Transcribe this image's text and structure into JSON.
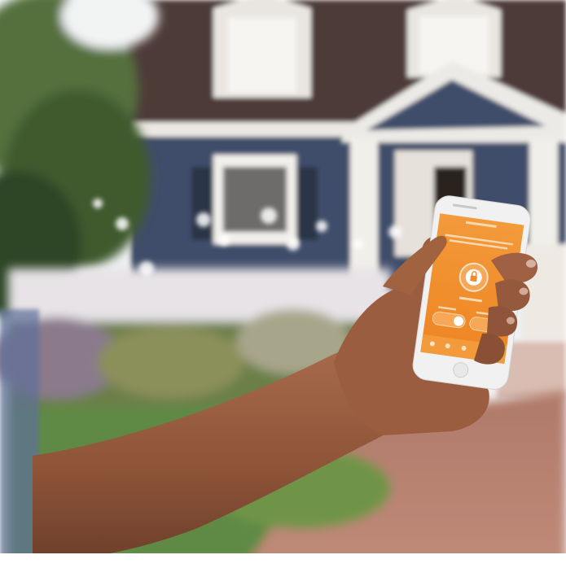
{
  "photo": {
    "palette": {
      "sky": "#f4f6f7",
      "roof": "#4d3b37",
      "siding": "#3f4d6a",
      "trim": "#f5f3ef",
      "foliage": "#4d6a38",
      "lawn": "#5f8a45",
      "path": "#b98172",
      "skin": "#9a5e42",
      "app_orange": "#f08c2e",
      "phone_frame": "#f1f1f1"
    },
    "phone_screen": {
      "app_header": "",
      "status_label": "",
      "button_left_label": "",
      "button_right_label": "",
      "lock_icon": "lock-icon",
      "tab_icons": [
        "tab-icon",
        "tab-icon",
        "tab-icon",
        "tab-icon",
        "tab-icon"
      ]
    }
  }
}
